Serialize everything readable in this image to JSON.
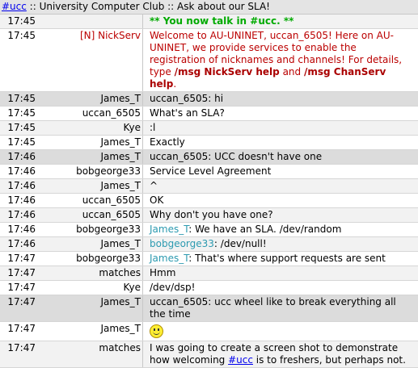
{
  "topic": {
    "channel_link": "#ucc",
    "rest": " :: University Computer Club :: Ask about our SLA!"
  },
  "rows": [
    {
      "time": "17:45",
      "nick": "",
      "msg": "** You now talk in #ucc. **",
      "kind": "sys"
    },
    {
      "time": "17:45",
      "nick": "[N] NickServ",
      "kind": "nickserv",
      "msg_parts": [
        {
          "text": "Welcome to AU-UNINET, uccan_6505! Here on AU-UNINET, we provide services to enable the registration of nicknames and channels! For details, type "
        },
        {
          "text": "/msg NickServ help",
          "bold": true
        },
        {
          "text": " and "
        },
        {
          "text": "/msg ChanServ help",
          "bold": true
        },
        {
          "text": "."
        }
      ]
    },
    {
      "time": "17:45",
      "nick": "James_T",
      "msg": "uccan_6505: hi",
      "kind": "self"
    },
    {
      "time": "17:45",
      "nick": "uccan_6505",
      "msg": "What's an SLA?"
    },
    {
      "time": "17:45",
      "nick": "Kye",
      "msg": ":l"
    },
    {
      "time": "17:45",
      "nick": "James_T",
      "msg": "Exactly"
    },
    {
      "time": "17:46",
      "nick": "James_T",
      "msg": "uccan_6505: UCC doesn't have one",
      "kind": "self"
    },
    {
      "time": "17:46",
      "nick": "bobgeorge33",
      "msg": "Service Level Agreement"
    },
    {
      "time": "17:46",
      "nick": "James_T",
      "msg": "^"
    },
    {
      "time": "17:46",
      "nick": "uccan_6505",
      "msg": "OK"
    },
    {
      "time": "17:46",
      "nick": "uccan_6505",
      "msg": "Why don't you have one?"
    },
    {
      "time": "17:46",
      "nick": "bobgeorge33",
      "kind": "hl",
      "hl": "James_T",
      "msg": ": We have an SLA. /dev/random"
    },
    {
      "time": "17:46",
      "nick": "James_T",
      "kind": "hl",
      "hl": "bobgeorge33",
      "msg": ": /dev/null!"
    },
    {
      "time": "17:47",
      "nick": "bobgeorge33",
      "kind": "hl",
      "hl": "James_T",
      "msg": ": That's where support requests are sent"
    },
    {
      "time": "17:47",
      "nick": "matches",
      "msg": "Hmm"
    },
    {
      "time": "17:47",
      "nick": "Kye",
      "msg": "/dev/dsp!"
    },
    {
      "time": "17:47",
      "nick": "James_T",
      "msg": "uccan_6505: ucc wheel like to break everything all the time",
      "kind": "self"
    },
    {
      "time": "17:47",
      "nick": "James_T",
      "msg": "",
      "kind": "smiley",
      "icon": "smiley-icon"
    },
    {
      "time": "17:47",
      "nick": "matches",
      "kind": "link",
      "msg_before": "I was going to create a screen shot to demonstrate how welcoming ",
      "link": "#ucc",
      "msg_after": " is to freshers, but perhaps not."
    }
  ]
}
